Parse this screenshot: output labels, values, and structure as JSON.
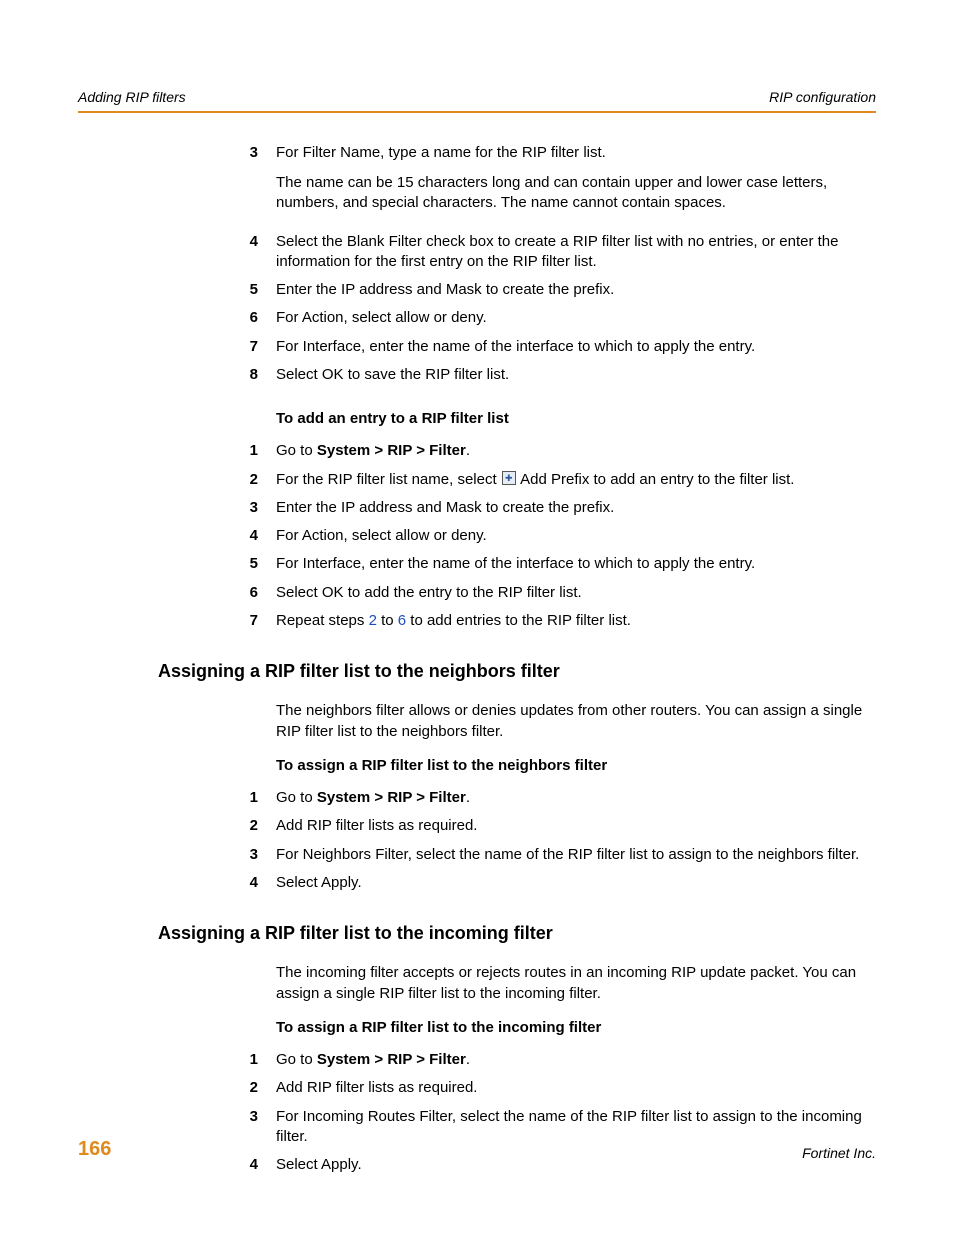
{
  "header": {
    "left": "Adding RIP filters",
    "right": "RIP configuration"
  },
  "section1": {
    "steps": [
      {
        "num": "3",
        "text": "For Filter Name, type a name for the RIP filter list.",
        "sub": "The name can be 15 characters long and can contain upper and lower case letters, numbers, and special characters. The name cannot contain spaces."
      },
      {
        "num": "4",
        "text": "Select the Blank Filter check box to create a RIP filter list with no entries, or enter the information for the first entry on the RIP filter list."
      },
      {
        "num": "5",
        "text": "Enter the IP address and Mask to create the prefix."
      },
      {
        "num": "6",
        "text": "For Action, select allow or deny."
      },
      {
        "num": "7",
        "text": "For Interface, enter the name of the interface to which to apply the entry."
      },
      {
        "num": "8",
        "text": "Select OK to save the RIP filter list."
      }
    ]
  },
  "section2": {
    "heading": "To add an entry to a RIP filter list",
    "step1": {
      "num": "1",
      "pre": "Go to ",
      "bold": "System > RIP > Filter",
      "post": "."
    },
    "step2": {
      "num": "2",
      "pre": "For the RIP filter list name, select ",
      "post": " Add Prefix to add an entry to the filter list."
    },
    "step3": {
      "num": "3",
      "text": "Enter the IP address and Mask to create the prefix."
    },
    "step4": {
      "num": "4",
      "text": "For Action, select allow or deny."
    },
    "step5": {
      "num": "5",
      "text": "For Interface, enter the name of the interface to which to apply the entry."
    },
    "step6": {
      "num": "6",
      "text": "Select OK to add the entry to the RIP filter list."
    },
    "step7": {
      "num": "7",
      "pre": "Repeat steps ",
      "link1": "2",
      "mid": " to ",
      "link2": "6",
      "post": " to add entries to the RIP filter list."
    }
  },
  "section3": {
    "title": "Assigning a RIP filter list to the neighbors filter",
    "intro": "The neighbors filter allows or denies updates from other routers. You can assign a single RIP filter list to the neighbors filter.",
    "heading": "To assign a RIP filter list to the neighbors filter",
    "step1": {
      "num": "1",
      "pre": "Go to ",
      "bold": "System > RIP > Filter",
      "post": "."
    },
    "step2": {
      "num": "2",
      "text": "Add RIP filter lists as required."
    },
    "step3": {
      "num": "3",
      "text": "For Neighbors Filter, select the name of the RIP filter list to assign to the neighbors filter."
    },
    "step4": {
      "num": "4",
      "text": "Select Apply."
    }
  },
  "section4": {
    "title": "Assigning a RIP filter list to the incoming filter",
    "intro": "The incoming filter accepts or rejects routes in an incoming RIP update packet. You can assign a single RIP filter list to the incoming filter.",
    "heading": "To assign a RIP filter list to the incoming filter",
    "step1": {
      "num": "1",
      "pre": "Go to ",
      "bold": "System > RIP > Filter",
      "post": "."
    },
    "step2": {
      "num": "2",
      "text": "Add RIP filter lists as required."
    },
    "step3": {
      "num": "3",
      "text": "For Incoming Routes Filter, select the name of the RIP filter list to assign to the incoming filter."
    },
    "step4": {
      "num": "4",
      "text": "Select Apply."
    }
  },
  "footer": {
    "page": "166",
    "right": "Fortinet Inc."
  }
}
